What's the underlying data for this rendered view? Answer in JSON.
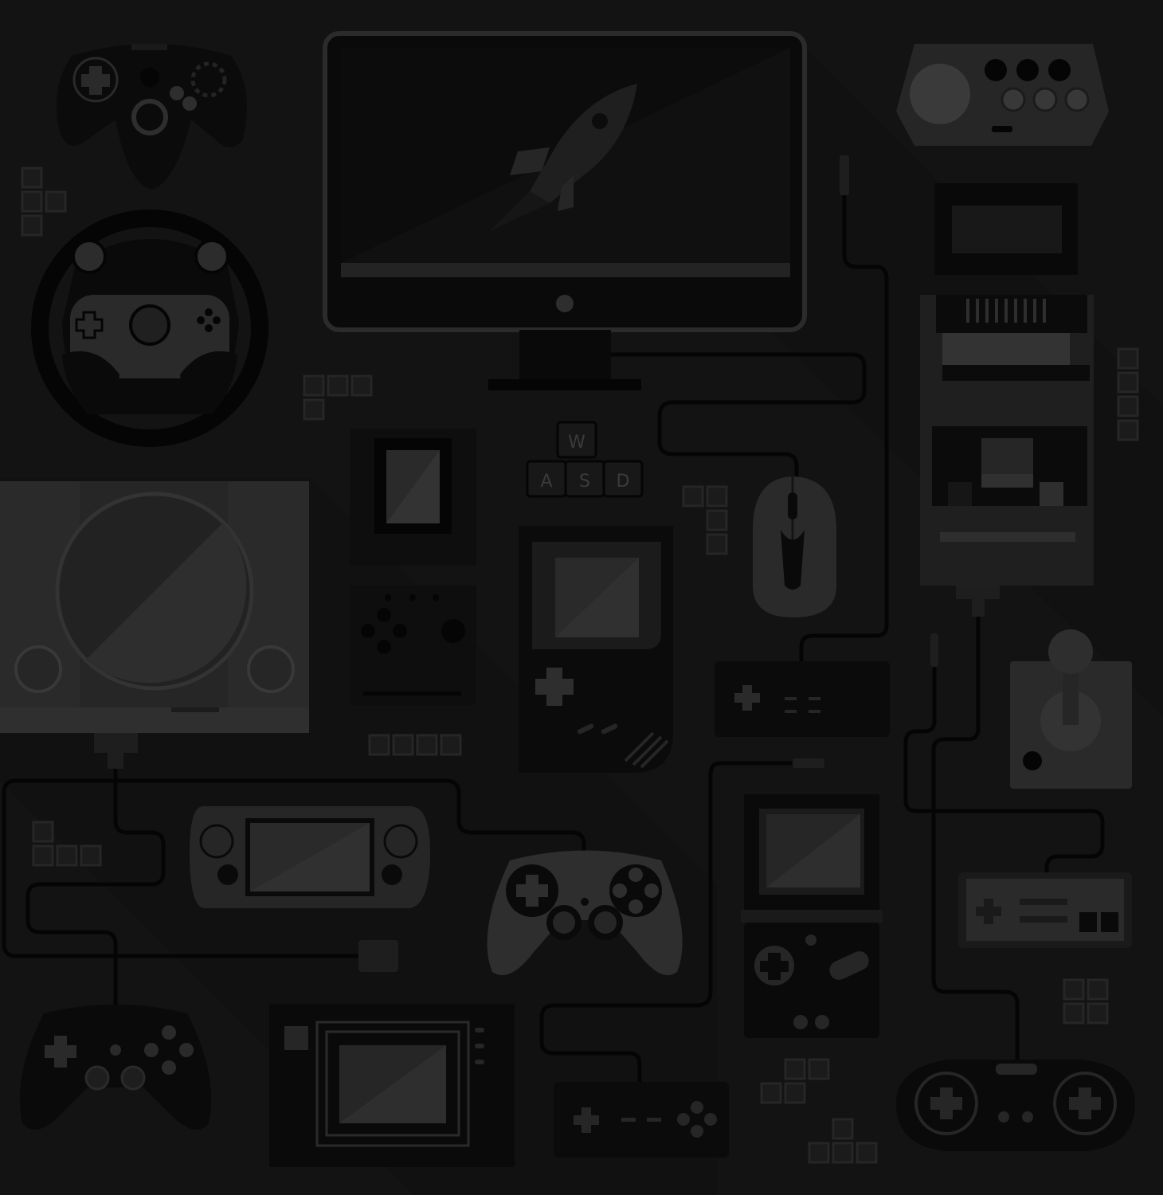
{
  "scene": {
    "palette": {
      "background": "#131313",
      "device_dark": "#0a0a0a",
      "device_mid": "#1c1c1c",
      "device_light": "#2c2c2c",
      "detail": "#3a3a3a",
      "cable": "#050505"
    },
    "keyboard_keys": [
      {
        "key": "w",
        "label": "W"
      },
      {
        "key": "a",
        "label": "A"
      },
      {
        "key": "s",
        "label": "S"
      },
      {
        "key": "d",
        "label": "D"
      }
    ],
    "icons": [
      "gamepad-icon",
      "arcade-stick-icon",
      "monitor-icon",
      "rocket-icon",
      "steering-wheel-icon",
      "cartridge-icon",
      "retro-console-icon",
      "disc-console-icon",
      "handheld-icon",
      "mouse-icon",
      "joystick-icon",
      "portable-console-icon",
      "tetromino-icon"
    ]
  }
}
